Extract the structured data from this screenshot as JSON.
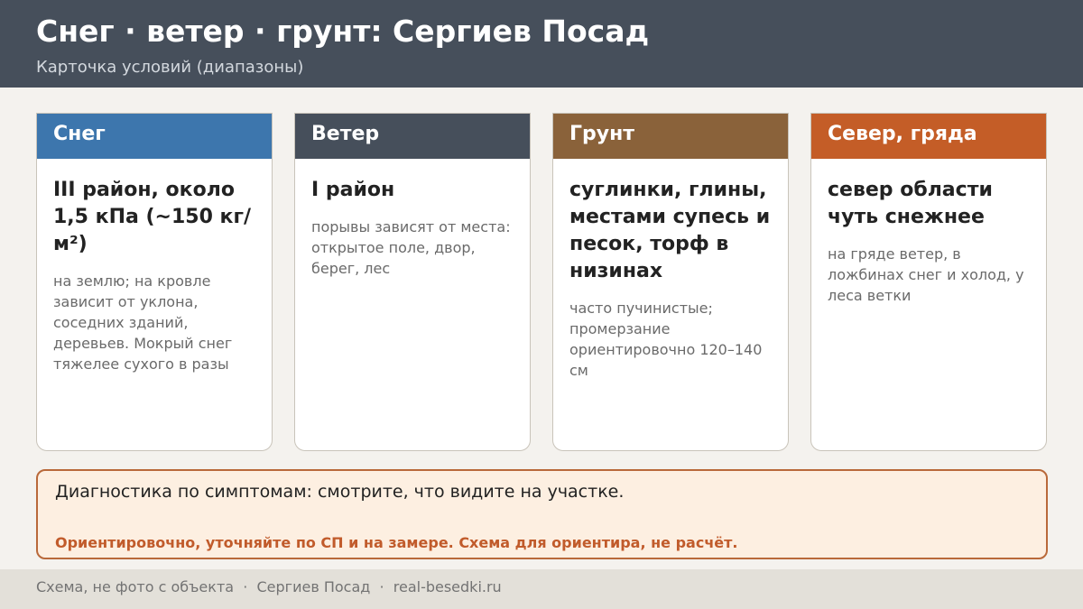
{
  "header": {
    "title": "Снег · ветер · грунт: Сергиев Посад",
    "subtitle": "Карточка условий (диапазоны)"
  },
  "cards": [
    {
      "heading": "Снег",
      "main": "III район, около 1,5 кПа (~150 кг/м²)",
      "note": "на землю; на кровле зависит от уклона, соседних зданий, деревьев. Мокрый снег тяжелее сухого в разы",
      "color": "#3d76ad"
    },
    {
      "heading": "Ветер",
      "main": "I район",
      "note": "порывы зависят от места: открытое поле, двор, берег, лес",
      "color": "#464f5b"
    },
    {
      "heading": "Грунт",
      "main": "суглинки, глины, местами супесь и песок, торф в низинах",
      "note": "часто пучинистые; промерзание ориентировочно 120–140 см",
      "color": "#8a623a"
    },
    {
      "heading": "Север, гряда",
      "main": "север области чуть снежнее",
      "note": "на гряде ветер, в ложбинах снег и холод, у леса ветки",
      "color": "#c45d27"
    }
  ],
  "diagnostics": {
    "text": "Диагностика по симптомам: смотрите, что видите на участке.",
    "note": "Ориентировочно, уточняйте по СП и на замере. Схема для ориентира, не расчёт."
  },
  "footer": {
    "text": "Схема, не фото с объекта  ·  Сергиев Посад  ·  real-besedki.ru"
  }
}
